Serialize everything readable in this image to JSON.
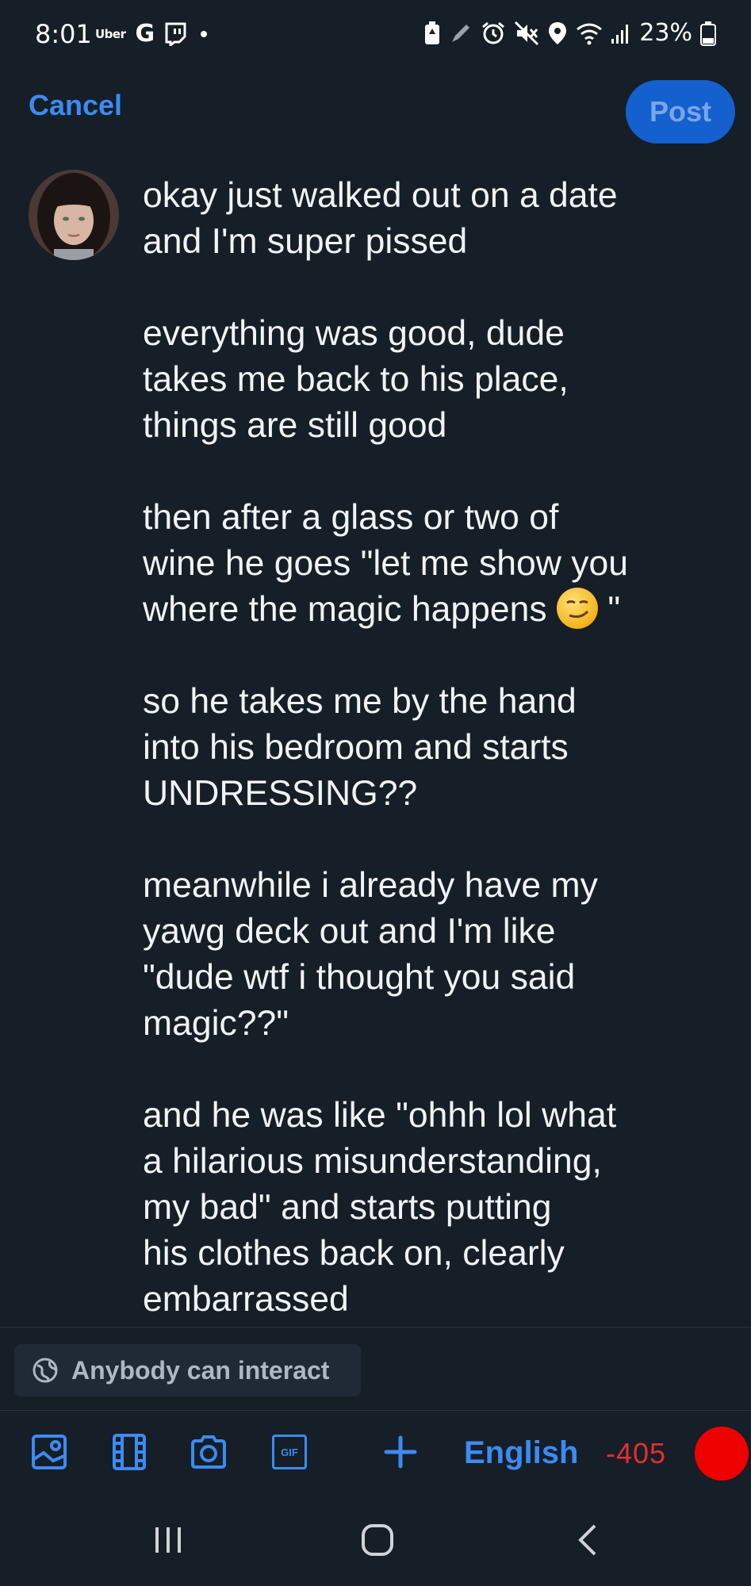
{
  "status_bar": {
    "time": "8:01",
    "app_icons": [
      "uber-icon",
      "google-icon",
      "twitch-icon"
    ],
    "uber_text": "Uber",
    "google_text": "G",
    "battery_percent": "23%",
    "right_icons": [
      "battery-saver-icon",
      "pen-icon",
      "alarm-icon",
      "mute-icon",
      "location-icon",
      "wifi-icon",
      "signal-icon",
      "battery-icon"
    ]
  },
  "header": {
    "cancel_label": "Cancel",
    "post_label": "Post"
  },
  "compose": {
    "paragraphs": [
      "okay just walked out on a date\nand I'm super pissed",
      "everything was good, dude\ntakes me back to his place,\nthings are still good",
      "then after a glass or two of\nwine he goes \"let me show you\nwhere the magic happens",
      "so he takes me by the hand\ninto his bedroom and starts\nUNDRESSING??",
      "meanwhile i already have my\nyawg deck out and I'm like\n\"dude wtf i thought you said\nmagic??\"",
      "and he was like \"ohhh lol what\na hilarious misunderstanding,\nmy bad\" and starts putting\nhis clothes back on, clearly\nembarrassed"
    ],
    "para3_suffix": " \"",
    "emoji_name": "smirking-face-emoji"
  },
  "interaction": {
    "label": "Anybody can interact"
  },
  "toolbar": {
    "image_icon": "image-icon",
    "video_icon": "video-icon",
    "camera_icon": "camera-icon",
    "gif_label": "GIF",
    "add_icon": "plus-icon",
    "language": "English",
    "char_count": "-405",
    "accent_color": "#3c8bf2",
    "over_limit_color": "#ee0000"
  },
  "nav": {
    "icons": [
      "recent-apps-icon",
      "home-icon",
      "back-icon"
    ]
  }
}
